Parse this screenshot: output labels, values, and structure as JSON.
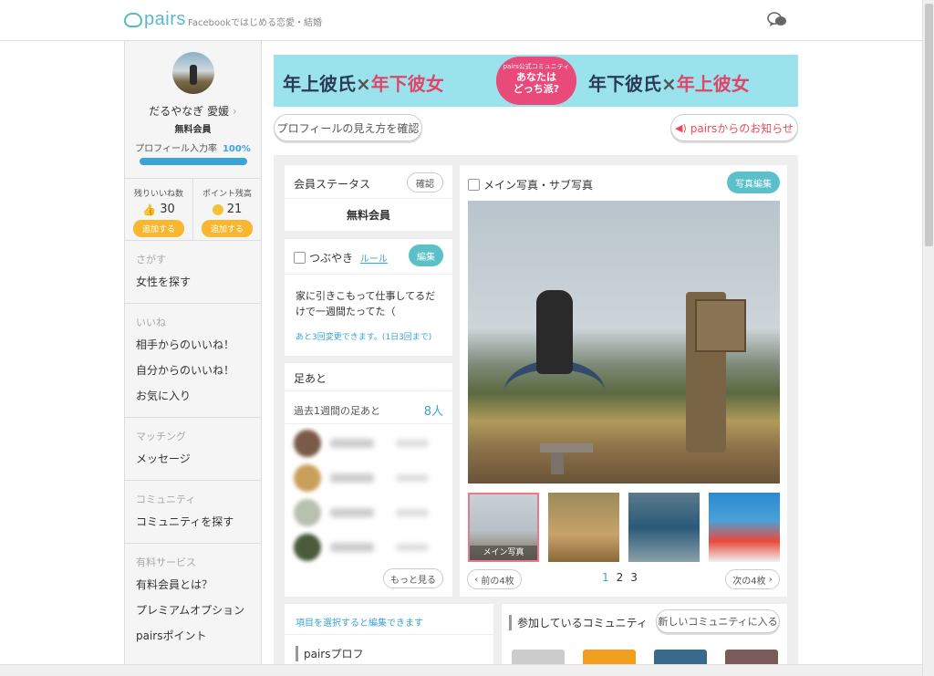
{
  "header": {
    "logo_text": "pairs",
    "tagline": "Facebookではじめる恋愛・結婚"
  },
  "sidebar": {
    "profile": {
      "name": "だるやなぎ 愛媛",
      "member_type": "無料会員",
      "completion_label": "プロフィール入力率",
      "completion_value": "100%",
      "completion_fraction": 1.0
    },
    "likes": {
      "label": "残りいいね数",
      "value": "30",
      "button": "追加する"
    },
    "points": {
      "label": "ポイント残高",
      "value": "21",
      "button": "追加する"
    },
    "groups": [
      {
        "head": "さがす",
        "items": [
          "女性を探す"
        ]
      },
      {
        "head": "いいね",
        "items": [
          "相手からのいいね！",
          "自分からのいいね！",
          "お気に入り"
        ]
      },
      {
        "head": "マッチング",
        "items": [
          "メッセージ"
        ]
      },
      {
        "head": "コミュニティ",
        "items": [
          "コミュニティを探す"
        ]
      },
      {
        "head": "有料サービス",
        "items": [
          "有料会員とは？",
          "プレミアムオプション",
          "pairsポイント"
        ]
      }
    ]
  },
  "banner": {
    "left_a": "年上彼氏",
    "left_x": "×",
    "left_b": "年下彼女",
    "center_small": "pairs公式コミュニティ",
    "center_q1": "あなたは",
    "center_q2": "どっち派?",
    "right_a": "年下彼氏",
    "right_x": "×",
    "right_b": "年上彼女"
  },
  "actions": {
    "profile_view": "プロフィールの見え方を確認",
    "notice": "pairsからのお知らせ"
  },
  "status": {
    "title": "会員ステータス",
    "confirm_button": "確認",
    "value": "無料会員"
  },
  "tweet": {
    "title": "つぶやき",
    "rule_link": "ルール",
    "edit_button": "編集",
    "text": "家に引きこもって仕事してるだけで一週間たってた（",
    "note": "あと3回変更できます。(1日3回まで)"
  },
  "footprints": {
    "title": "足あと",
    "week_label": "過去1週間の足あと",
    "count": "8人",
    "more_button": "もっと見る"
  },
  "photos": {
    "title": "メイン写真・サブ写真",
    "edit_button": "写真編集",
    "main_caption": "メイン写真",
    "prev": "前の4枚",
    "next": "次の4枚",
    "pages": [
      "1",
      "2",
      "3"
    ],
    "current_page": "1"
  },
  "bottom": {
    "hint": "項目を選択すると編集できます",
    "prof_title": "pairsプロフ",
    "community_title": "参加しているコミュニティ",
    "new_community_button": "新しいコミュニティに入る"
  },
  "colors": {
    "accent": "#5bc0c8",
    "blue": "#3aa3d8",
    "orange": "#f7b731",
    "pink": "#e94a7a"
  }
}
